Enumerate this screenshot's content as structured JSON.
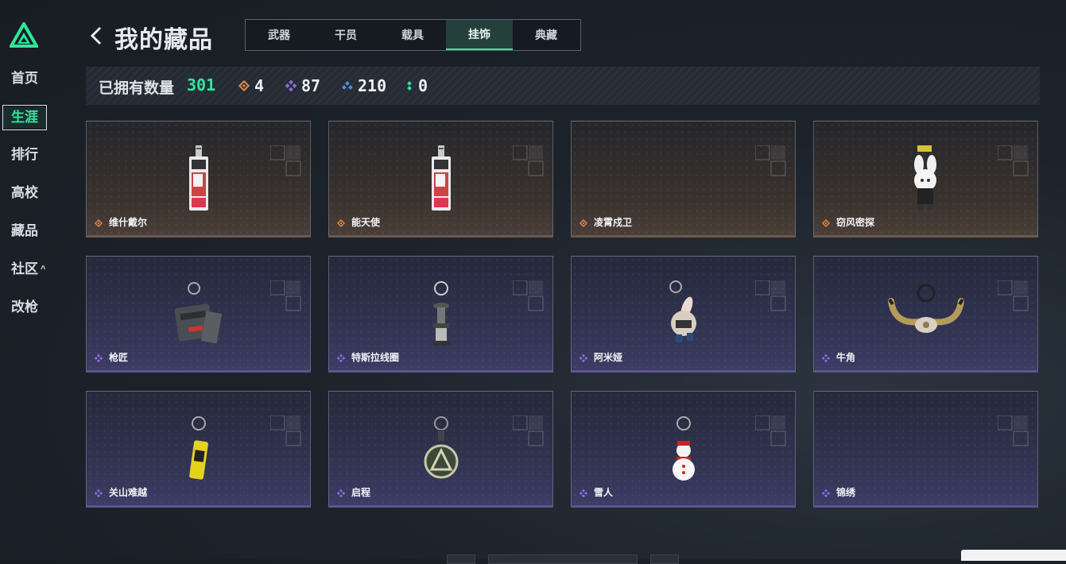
{
  "app": {
    "logo": "triangle-logo"
  },
  "nav": {
    "items": [
      {
        "label": "首页"
      },
      {
        "label": "生涯"
      },
      {
        "label": "排行"
      },
      {
        "label": "高校"
      },
      {
        "label": "藏品"
      },
      {
        "label": "社区"
      },
      {
        "label": "改枪"
      }
    ],
    "community_caret": "^"
  },
  "header": {
    "title": "我的藏品",
    "tabs": [
      {
        "label": "武器"
      },
      {
        "label": "干员"
      },
      {
        "label": "载具"
      },
      {
        "label": "挂饰"
      },
      {
        "label": "典藏"
      }
    ],
    "active_tab": "挂饰"
  },
  "stats": {
    "owned_label": "已拥有数量",
    "owned_total": "301",
    "gold": "4",
    "purple": "87",
    "blue": "210",
    "green": "0",
    "colors": {
      "gold": "#e0864a",
      "purple": "#8f6de0",
      "blue": "#4f90e0",
      "green": "#2ee89a"
    }
  },
  "cards": [
    {
      "name": "维什戴尔",
      "rarity": "gold",
      "icon": "card-keychain-icon"
    },
    {
      "name": "能天使",
      "rarity": "gold",
      "icon": "card-keychain-icon"
    },
    {
      "name": "凌霄戍卫",
      "rarity": "gold",
      "icon": ""
    },
    {
      "name": "窃风密探",
      "rarity": "gold",
      "icon": "white-rabbit-figure-icon"
    },
    {
      "name": "枪匠",
      "rarity": "purple",
      "icon": "toolbox-keychain-icon"
    },
    {
      "name": "特斯拉线圈",
      "rarity": "purple",
      "icon": "tesla-coil-keychain-icon"
    },
    {
      "name": "阿米娅",
      "rarity": "purple",
      "icon": "amiya-figure-keychain-icon"
    },
    {
      "name": "牛角",
      "rarity": "purple",
      "icon": "bull-horn-keychain-icon"
    },
    {
      "name": "关山难越",
      "rarity": "purple",
      "icon": "yellow-can-keychain-icon"
    },
    {
      "name": "启程",
      "rarity": "purple",
      "icon": "medal-keychain-icon"
    },
    {
      "name": "雪人",
      "rarity": "purple",
      "icon": "snowman-keychain-icon"
    },
    {
      "name": "锦绣",
      "rarity": "purple",
      "icon": ""
    }
  ]
}
